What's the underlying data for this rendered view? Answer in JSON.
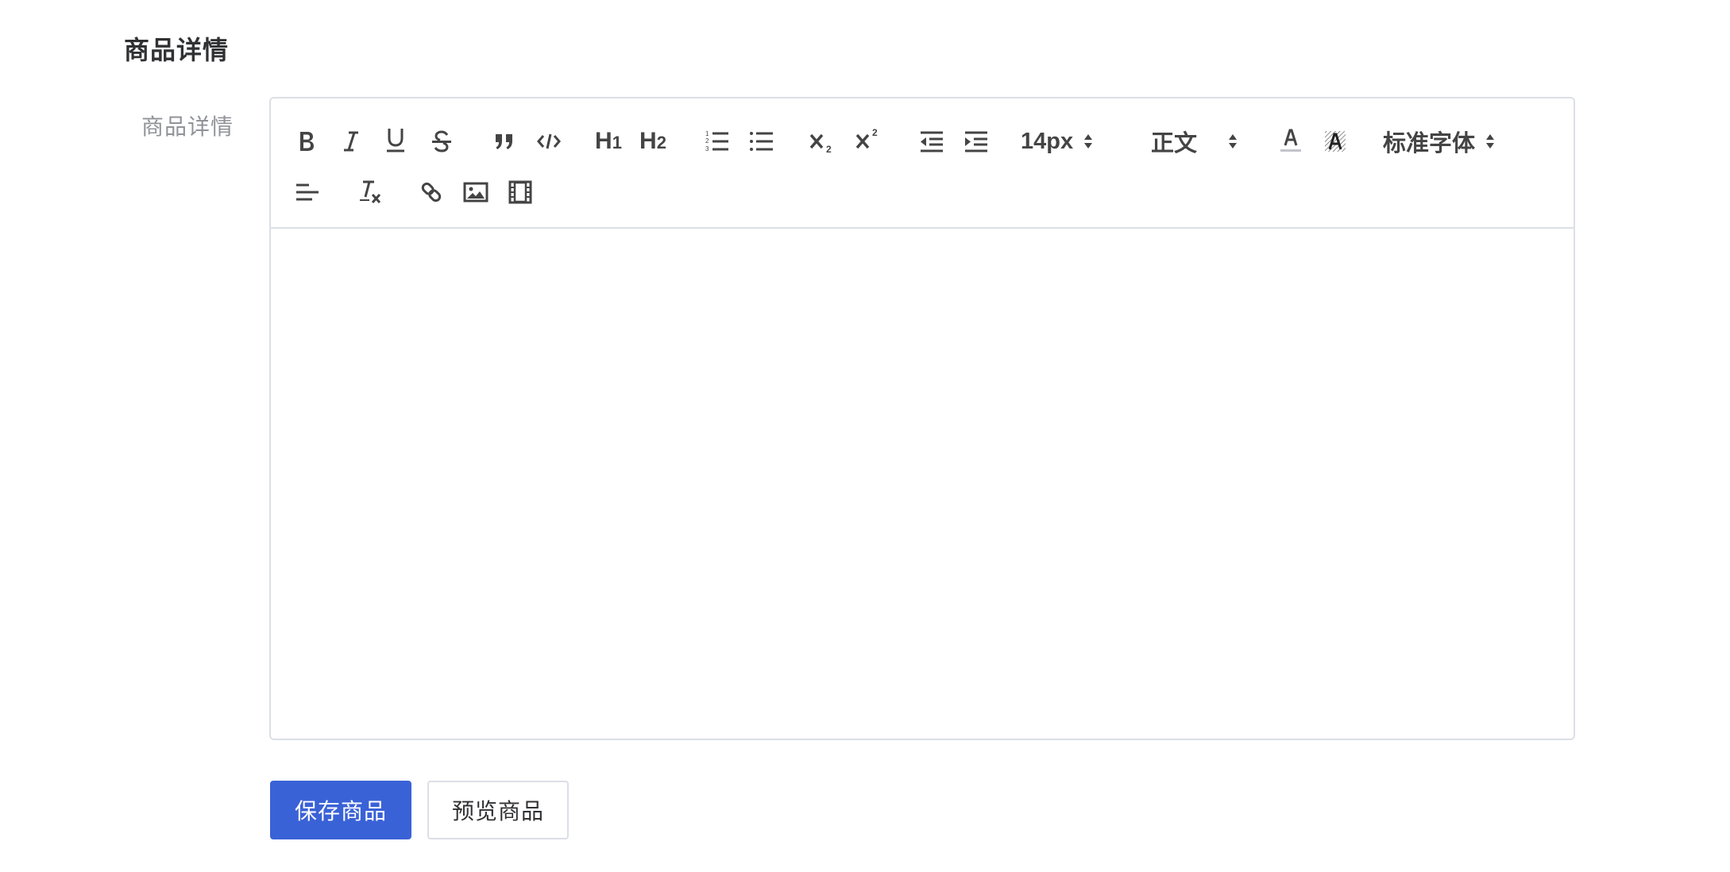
{
  "section": {
    "title": "商品详情"
  },
  "form": {
    "label": "商品详情"
  },
  "toolbar": {
    "header1": "H1",
    "header2": "H2",
    "font_size": "14px",
    "header_style": "正文",
    "font_family": "标准字体",
    "icons": [
      "bold-icon",
      "italic-icon",
      "underline-icon",
      "strike-icon",
      "blockquote-icon",
      "code-block-icon",
      "header-1-icon",
      "header-2-icon",
      "ordered-list-icon",
      "bullet-list-icon",
      "subscript-icon",
      "superscript-icon",
      "outdent-icon",
      "indent-icon",
      "text-color-icon",
      "background-color-icon",
      "align-icon",
      "clean-format-icon",
      "link-icon",
      "image-icon",
      "video-icon"
    ]
  },
  "editor": {
    "content": ""
  },
  "actions": {
    "save": "保存商品",
    "preview": "预览商品"
  },
  "colors": {
    "primary": "#3a62d7",
    "border": "#dcdfe6",
    "label": "#909399",
    "icon": "#444444"
  }
}
